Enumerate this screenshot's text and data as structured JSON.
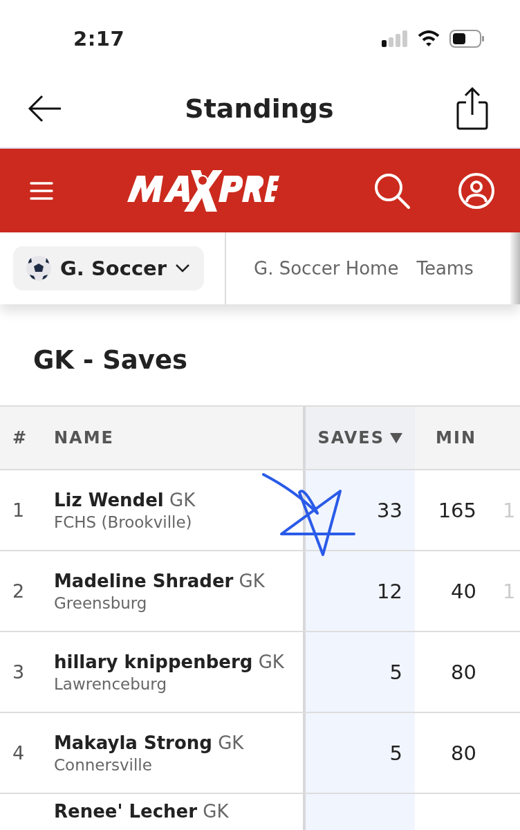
{
  "status_bar": {
    "time": "2:17"
  },
  "nav_bar": {
    "title": "Standings"
  },
  "sport_selector": {
    "label": "G. Soccer"
  },
  "sub_nav": {
    "links": [
      {
        "label": "G. Soccer Home"
      },
      {
        "label": "Teams"
      }
    ]
  },
  "section_title": "GK - Saves",
  "table": {
    "columns": [
      {
        "label": "#",
        "sorted": false
      },
      {
        "label": "NAME",
        "sorted": false
      },
      {
        "label": "SAVES",
        "sorted": true
      },
      {
        "label": "MIN",
        "sorted": false
      }
    ],
    "rows": [
      {
        "rank": "1",
        "name": "**Liz Wendel** GK",
        "school": "FCHS (Brookville)",
        "saves": "33",
        "min": "165",
        "column_5": "1"
      },
      {
        "rank": "2",
        "name": "**Madeline Shrader** GK",
        "school": "Greensburg",
        "saves": "12",
        "min": "40",
        "column_5": "1"
      },
      {
        "rank": "3",
        "name": "**hillary knippenberg** GK",
        "school": "Lawrenceburg",
        "saves": "5",
        "min": "80"
      },
      {
        "rank": "4",
        "name": "**Makayla Strong** GK",
        "school": "Connersville",
        "saves": "5",
        "min": "80"
      },
      {
        "name": "**Renee' Lecher** GK"
      }
    ]
  }
}
